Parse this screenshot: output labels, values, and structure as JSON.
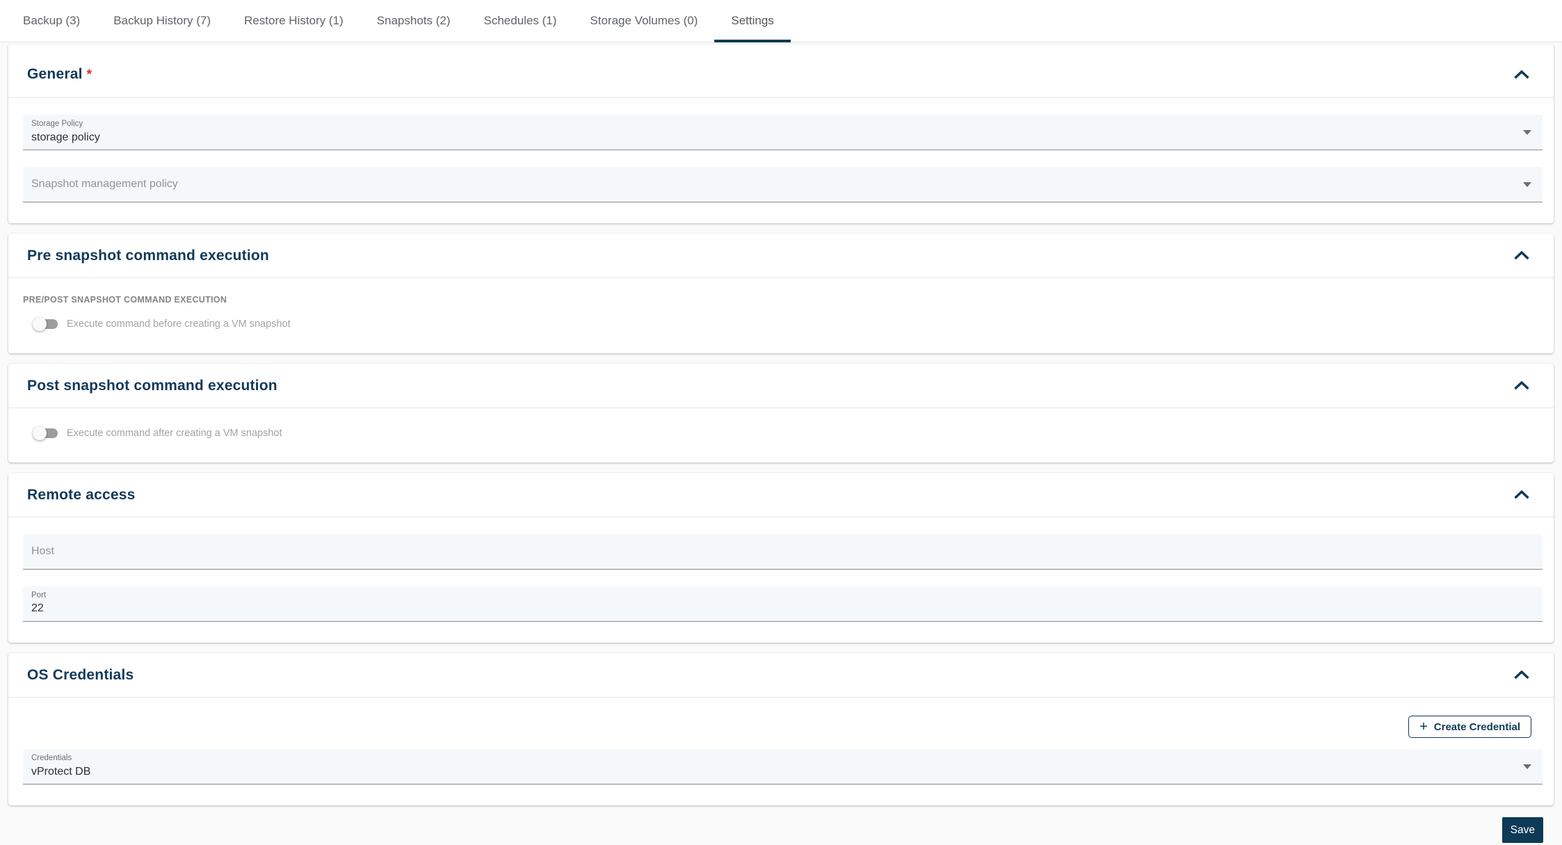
{
  "colors": {
    "accent_navy": "#0d3a56",
    "heading_navy": "#12395a",
    "required_red": "#d32f2f",
    "field_background": "#f4f8fb",
    "tab_text_gray": "#5f6368",
    "save_button_bg": "#0d3a56"
  },
  "tabs": [
    {
      "label": "Backup (3)",
      "active": false
    },
    {
      "label": "Backup History (7)",
      "active": false
    },
    {
      "label": "Restore History (1)",
      "active": false
    },
    {
      "label": "Snapshots (2)",
      "active": false
    },
    {
      "label": "Schedules (1)",
      "active": false
    },
    {
      "label": "Storage Volumes (0)",
      "active": false
    },
    {
      "label": "Settings",
      "active": true
    }
  ],
  "general": {
    "title": "General",
    "required_marker": "*",
    "storage_policy": {
      "label": "Storage Policy",
      "value": "storage policy"
    },
    "snapshot_management_policy": {
      "placeholder": "Snapshot management policy",
      "value": ""
    }
  },
  "pre_snapshot": {
    "title": "Pre snapshot command execution",
    "group_label": "PRE/POST SNAPSHOT COMMAND EXECUTION",
    "toggle": {
      "label": "Execute command before creating a VM snapshot",
      "state": "off"
    }
  },
  "post_snapshot": {
    "title": "Post snapshot command execution",
    "toggle": {
      "label": "Execute command after creating a VM snapshot",
      "state": "off"
    }
  },
  "remote_access": {
    "title": "Remote access",
    "host": {
      "placeholder": "Host",
      "value": ""
    },
    "port": {
      "label": "Port",
      "value": "22"
    }
  },
  "os_credentials": {
    "title": "OS Credentials",
    "create_button": {
      "plus_glyph": "+",
      "label": "Create Credential"
    },
    "credentials": {
      "label": "Credentials",
      "value": "vProtect DB"
    }
  },
  "footer": {
    "save_label": "Save"
  }
}
